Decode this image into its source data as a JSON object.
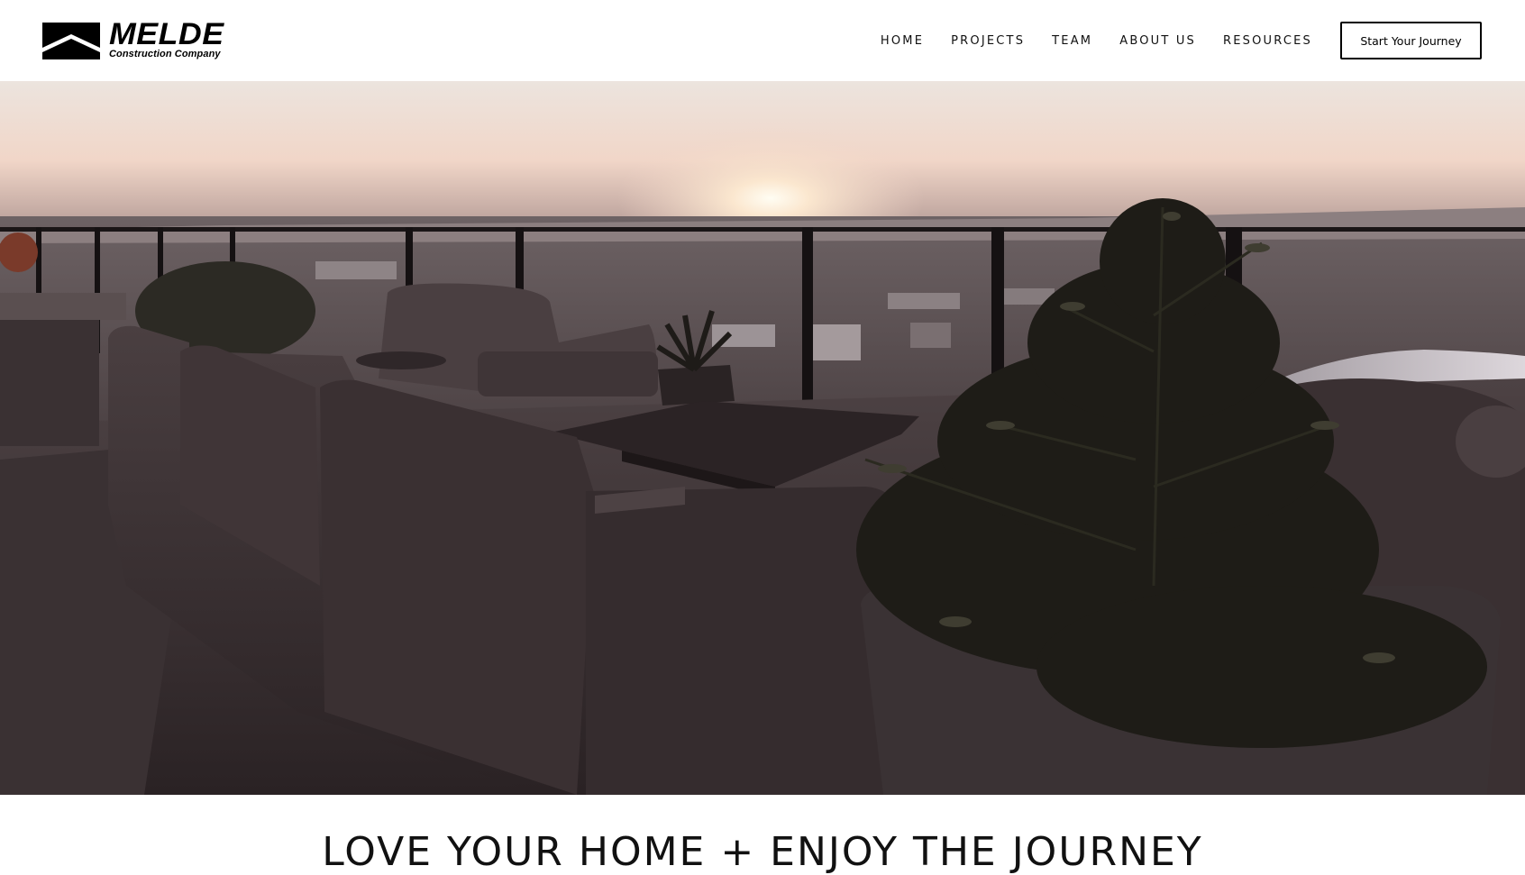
{
  "brand": {
    "name": "MELDE",
    "subtitle": "Construction Company"
  },
  "nav": {
    "items": [
      {
        "label": "HOME"
      },
      {
        "label": "PROJECTS"
      },
      {
        "label": "TEAM"
      },
      {
        "label": "ABOUT US"
      },
      {
        "label": "RESOURCES"
      }
    ],
    "cta_label": "Start Your Journey"
  },
  "hero": {
    "image_subject": "rooftop-terrace-sunset"
  },
  "headline": "LOVE YOUR HOME + ENJOY THE JOURNEY",
  "colors": {
    "text": "#111111",
    "background": "#ffffff",
    "button_border": "#000000"
  }
}
